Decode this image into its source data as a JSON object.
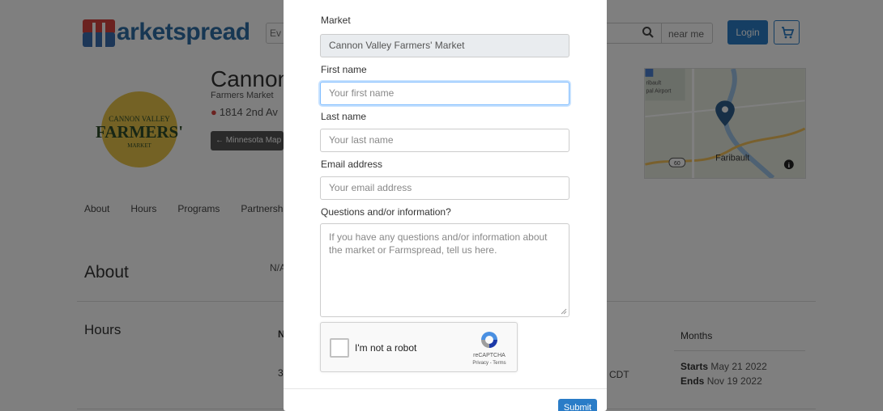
{
  "header": {
    "brand": "arketspread",
    "search_stub": "Ev",
    "near_me": "near me",
    "login": "Login"
  },
  "market": {
    "name": "Cannon",
    "type": "Farmers Market",
    "address": "1814 2nd Av",
    "map_button": "Minnesota Map",
    "logo_line1": "CANNON VALLEY",
    "logo_line2": "FARMERS'",
    "logo_line3": "MARKET",
    "map_city": "Faribault",
    "map_airport1": "ribault",
    "map_airport2": "pal Airport",
    "map_route": "60"
  },
  "nav": {
    "items": [
      "About",
      "Hours",
      "Programs",
      "Partnersh"
    ]
  },
  "about": {
    "heading": "About",
    "value": "N/A"
  },
  "hours": {
    "heading": "Hours",
    "col_n": "N",
    "row_first": "3",
    "time_suffix": "CDT",
    "months_heading": "Months",
    "starts_label": "Starts",
    "starts_value": "May 21 2022",
    "ends_label": "Ends",
    "ends_value": "Nov 19 2022"
  },
  "modal": {
    "market_label": "Market",
    "market_value": "Cannon Valley Farmers' Market",
    "first_name_label": "First name",
    "first_name_placeholder": "Your first name",
    "last_name_label": "Last name",
    "last_name_placeholder": "Your last name",
    "email_label": "Email address",
    "email_placeholder": "Your email address",
    "questions_label": "Questions and/or information?",
    "questions_placeholder": "If you have any questions and/or information about the market or Farmspread, tell us here.",
    "recaptcha_text": "I'm not a robot",
    "recaptcha_brand": "reCAPTCHA",
    "recaptcha_terms": "Privacy - Terms",
    "submit": "Submit"
  },
  "colors": {
    "brand_blue": "#2a7cc7",
    "brand_red": "#d64541",
    "overlay": "rgba(0,0,0,0.5)"
  },
  "icons": [
    "search-icon",
    "cart-icon",
    "pin-icon",
    "arrow-left-icon",
    "map-marker-icon",
    "info-icon",
    "recaptcha-logo-icon"
  ]
}
